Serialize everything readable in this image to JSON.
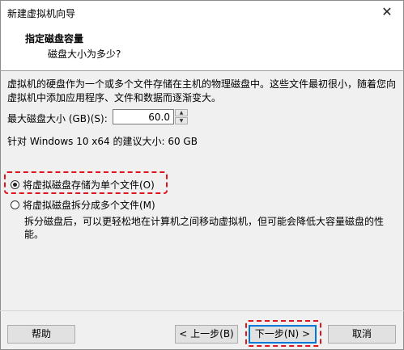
{
  "window": {
    "title": "新建虚拟机向导",
    "close_glyph": "✕"
  },
  "header": {
    "title": "指定磁盘容量",
    "subtitle": "磁盘大小为多少?"
  },
  "description": "虚拟机的硬盘作为一个或多个文件存储在主机的物理磁盘中。这些文件最初很小，随着您向虚拟机中添加应用程序、文件和数据而逐渐变大。",
  "disk_size": {
    "label": "最大磁盘大小 (GB)(S):",
    "value": "60.0",
    "spin_up": "▲",
    "spin_down": "▼"
  },
  "recommended": "针对 Windows 10 x64 的建议大小: 60 GB",
  "options": {
    "single": {
      "label": "将虚拟磁盘存储为单个文件(O)",
      "checked": true
    },
    "split": {
      "label": "将虚拟磁盘拆分成多个文件(M)",
      "checked": false,
      "description": "拆分磁盘后，可以更轻松地在计算机之间移动虚拟机，但可能会降低大容量磁盘的性能。"
    }
  },
  "buttons": {
    "help": "帮助",
    "back": "< 上一步(B)",
    "next": "下一步(N) >",
    "cancel": "取消"
  },
  "colors": {
    "highlight": "#e0141e",
    "primary_border": "#0078d7"
  }
}
